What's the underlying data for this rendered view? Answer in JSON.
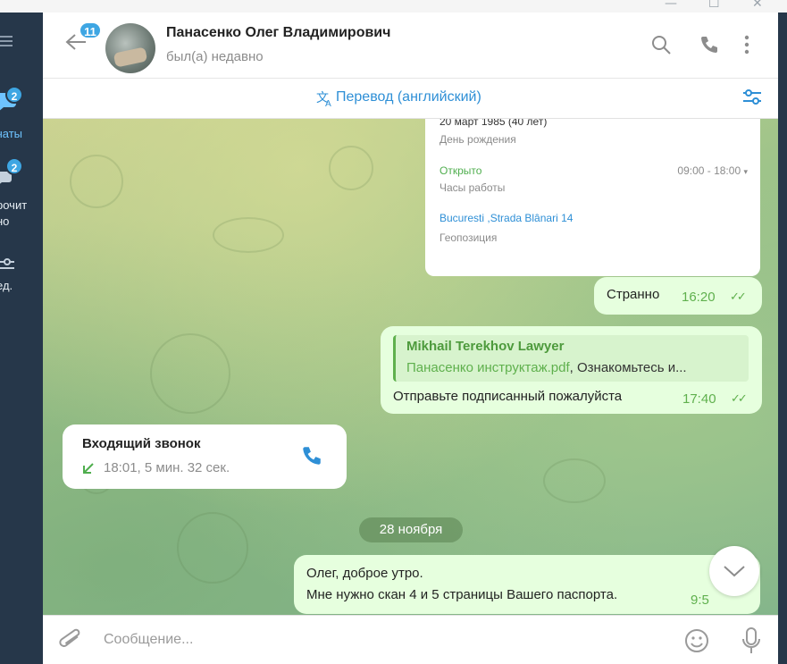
{
  "window": {
    "controls": [
      "—",
      "☐",
      "✕"
    ]
  },
  "sidebar": {
    "menu_icon": "hamburger-icon",
    "items": [
      {
        "label": "Чаты",
        "badge": "2",
        "icon": "chats-icon",
        "active": true
      },
      {
        "label": "Непрочит\nано",
        "badge": "2",
        "icon": "unread-icon"
      },
      {
        "label": "Ред.",
        "icon": "edit-filters-icon"
      }
    ],
    "label_chats": "чаты",
    "label_unread_1": "рочит",
    "label_unread_2": "но",
    "label_edit": "ед."
  },
  "header": {
    "back_icon": "back-arrow-icon",
    "unread_count": "11",
    "name": "Панасенко Олег Владимирович",
    "status": "был(а) недавно",
    "icons": [
      "search-icon",
      "phone-icon",
      "more-icon"
    ]
  },
  "translate_bar": {
    "label": "Перевод (английский)",
    "icon": "translate-icon",
    "settings_icon": "filter-settings-icon"
  },
  "profile_card": {
    "birthday_value": "20 март 1985 (40 лет)",
    "birthday_label": "День рождения",
    "hours_status": "Открыто",
    "hours_value": "09:00 - 18:00",
    "hours_label": "Часы работы",
    "location_value": "Bucuresti ,Strada Blânari 14",
    "location_label": "Геопозиция"
  },
  "messages": [
    {
      "type": "outgoing",
      "text": "Странно",
      "time": "16:20",
      "read": true
    },
    {
      "type": "outgoing",
      "reply_author": "Mikhail Terekhov Lawyer",
      "reply_file": "Панасенко инструктаж.pdf",
      "reply_rest": ", Ознакомьтесь и...",
      "text": "Отправьте подписанный пожалуйста",
      "time": "17:40",
      "read": true
    },
    {
      "type": "incoming_call",
      "title": "Входящий звонок",
      "detail": "18:01, 5 мин. 32 сек."
    },
    {
      "type": "date",
      "text": "28 ноября"
    },
    {
      "type": "outgoing",
      "line1": "Олег, доброе утро.",
      "line2": "Мне нужно скан 4 и 5 страницы Вашего паспорта.",
      "time": "9:5"
    }
  ],
  "composer": {
    "placeholder": "Сообщение...",
    "icons": [
      "attach-icon",
      "emoji-icon",
      "microphone-icon"
    ]
  },
  "colors": {
    "accent": "#3ea6e3",
    "outgoing_bubble": "#e6ffde",
    "time_green": "#5fb04d",
    "sidebar_bg": "#26374a"
  }
}
